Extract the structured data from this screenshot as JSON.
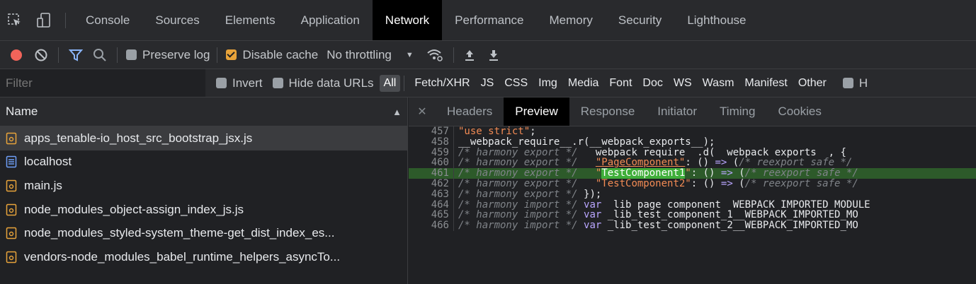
{
  "main_tabs": [
    "Console",
    "Sources",
    "Elements",
    "Application",
    "Network",
    "Performance",
    "Memory",
    "Security",
    "Lighthouse"
  ],
  "active_main_tab": "Network",
  "toolbar": {
    "preserve_log_label": "Preserve log",
    "disable_cache_label": "Disable cache",
    "throttling_value": "No throttling"
  },
  "filter_bar": {
    "placeholder": "Filter",
    "invert_label": "Invert",
    "hide_data_urls_label": "Hide data URLs",
    "types": [
      "All",
      "Fetch/XHR",
      "JS",
      "CSS",
      "Img",
      "Media",
      "Font",
      "Doc",
      "WS",
      "Wasm",
      "Manifest",
      "Other"
    ],
    "active_type": "All"
  },
  "requests": {
    "name_header": "Name",
    "sort_icon": "triangle-up-icon",
    "items": [
      {
        "name": "apps_tenable-io_host_src_bootstrap_jsx.js",
        "icon": "script-file-icon",
        "selected": true
      },
      {
        "name": "localhost",
        "icon": "document-file-icon",
        "selected": false
      },
      {
        "name": "main.js",
        "icon": "script-file-icon",
        "selected": false
      },
      {
        "name": "node_modules_object-assign_index_js.js",
        "icon": "script-file-icon",
        "selected": false
      },
      {
        "name": "node_modules_styled-system_theme-get_dist_index_es...",
        "icon": "script-file-icon",
        "selected": false
      },
      {
        "name": "vendors-node_modules_babel_runtime_helpers_asyncTo...",
        "icon": "script-file-icon",
        "selected": false
      }
    ]
  },
  "detail_tabs": [
    "Headers",
    "Preview",
    "Response",
    "Initiator",
    "Timing",
    "Cookies"
  ],
  "active_detail_tab": "Preview",
  "close_icon": "close-icon",
  "code_lines": [
    {
      "num": "457",
      "parts": [
        [
          "str",
          "\"use strict\""
        ],
        [
          "",
          ";"
        ]
      ]
    },
    {
      "num": "458",
      "parts": [
        [
          "",
          "__webpack_require__.r(__webpack_exports__);"
        ]
      ]
    },
    {
      "num": "459",
      "parts": [
        [
          "c",
          "/* harmony export */ "
        ],
        [
          "",
          "__webpack_require__.d(__webpack_exports__, {"
        ]
      ]
    },
    {
      "num": "460",
      "parts": [
        [
          "c",
          "/* harmony export */ "
        ],
        [
          "",
          "  "
        ],
        [
          "s",
          "\"PageComponent\""
        ],
        [
          "",
          ": () "
        ],
        [
          "k",
          "=>"
        ],
        [
          "",
          " ("
        ],
        [
          "c",
          "/* reexport safe */"
        ]
      ]
    },
    {
      "num": "461",
      "highlight": true,
      "parts": [
        [
          "c",
          "/* harmony export */ "
        ],
        [
          "",
          "  "
        ],
        [
          "str",
          "\""
        ],
        [
          "hl",
          "TestComponent1"
        ],
        [
          "str",
          "\""
        ],
        [
          "",
          ": () "
        ],
        [
          "k",
          "=>"
        ],
        [
          "",
          " ("
        ],
        [
          "c",
          "/* reexport safe */"
        ]
      ]
    },
    {
      "num": "462",
      "parts": [
        [
          "c",
          "/* harmony export */ "
        ],
        [
          "",
          "  "
        ],
        [
          "str",
          "\"TestComponent2\""
        ],
        [
          "",
          ": () "
        ],
        [
          "k",
          "=>"
        ],
        [
          "",
          " ("
        ],
        [
          "c",
          "/* reexport safe */"
        ]
      ]
    },
    {
      "num": "463",
      "parts": [
        [
          "c",
          "/* harmony export */ "
        ],
        [
          "",
          "});"
        ]
      ]
    },
    {
      "num": "464",
      "parts": [
        [
          "c",
          "/* harmony import */ "
        ],
        [
          "k",
          "var"
        ],
        [
          "",
          " _lib_page_component__WEBPACK_IMPORTED_MODULE"
        ]
      ]
    },
    {
      "num": "465",
      "parts": [
        [
          "c",
          "/* harmony import */ "
        ],
        [
          "k",
          "var"
        ],
        [
          "",
          " _lib_test_component_1__WEBPACK_IMPORTED_MO"
        ]
      ]
    },
    {
      "num": "466",
      "parts": [
        [
          "c",
          "/* harmony import */ "
        ],
        [
          "k",
          "var"
        ],
        [
          "",
          " _lib_test_component_2__WEBPACK_IMPORTED_MO"
        ]
      ]
    }
  ],
  "colors": {
    "record_red": "#f2645a",
    "filter_blue": "#8ab4f8",
    "active_tab_bg": "#000000",
    "highlight_line": "#2d5a2a",
    "highlight_word": "#3fae3a"
  }
}
